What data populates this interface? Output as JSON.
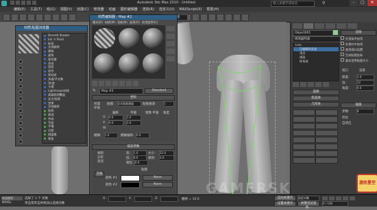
{
  "window": {
    "title": "Autodesk 3ds Max 2010 - Untitled",
    "search_placeholder": "键入关键字或短语"
  },
  "menu": {
    "items": [
      "编辑(E)",
      "工具(T)",
      "组(G)",
      "视图(V)",
      "创建(C)",
      "修改器",
      "动画",
      "图形编辑器",
      "渲染(R)",
      "自定义(U)",
      "MAXScript(X)",
      "帮助(H)"
    ]
  },
  "toolbar": {
    "selection_filter": "全部",
    "view_dropdown": "视图"
  },
  "slate_dialog": {
    "title": "材质/贴图浏览器",
    "list_items": [
      "DirectX Shader",
      "Ink 'n Paint",
      "标准",
      "光线跟踪",
      "建筑",
      "虚拟",
      "变形器",
      "合成",
      "双面",
      "混合",
      "壳材质",
      "多维/子对象",
      "顶/底",
      "卡通",
      "Lightscape材质",
      "高级照明覆盖",
      "无光/投影",
      "虫漆",
      "光线跟踪",
      "贴图",
      "衰减",
      "合成",
      "平面",
      "平铺",
      "位图",
      "棋盘格",
      "渐变"
    ]
  },
  "material_editor": {
    "title": "材质编辑器 - Map #2",
    "menu": [
      "模式(D)",
      "材质(M)",
      "导航(N)",
      "选项(O)",
      "实用程序(U)"
    ],
    "map_name": "Map #2",
    "map_type": "Standard",
    "rollout_coords": "坐标",
    "rollout_noise": "噪波参数",
    "coords": {
      "texture_label": "纹理",
      "env_label": "环境",
      "mapping_label": "贴图:",
      "mapping_value": "显式贴图通道",
      "channel_label": "贴图通道:",
      "channel_value": "1",
      "offset_label": "偏移",
      "tiling_label": "平铺",
      "mirror_tile": "镜像 平铺",
      "angle_label": "角度",
      "u_label": "U:",
      "v_label": "V:",
      "w_label": "W:",
      "u_value": "0.0",
      "v_value": "0.0",
      "tile_u": "1.0",
      "tile_v": "1.0",
      "blur_label": "模糊:",
      "blur_value": "1.0",
      "blur_offset_label": "模糊偏移:",
      "blur_offset_value": "0.0"
    },
    "noise": {
      "type_regular": "规则",
      "type_fractal": "分形",
      "type_turbulence": "湍流",
      "threshold_high_label": "高:",
      "threshold_high": "1.0",
      "threshold_low_label": "低:",
      "threshold_low": "0.0",
      "size_label": "大小:",
      "size_value": "25.0",
      "phase_label": "相位:",
      "phase_value": "0.0",
      "levels_label": "级别:",
      "levels_value": "3.0",
      "color1_label": "颜色 #1",
      "color2_label": "颜色 #2",
      "maps_label": "贴图",
      "none1": "None",
      "none2": "None",
      "swap": "交换"
    }
  },
  "command_panel": {
    "object_name": "Object001",
    "modifier_list": "修改器列表",
    "stack": [
      "Line",
      "可编辑样条线",
      "顶点",
      "线段",
      "样条线"
    ],
    "params_title": "参数",
    "rollout_selection": "选择",
    "rollout_soft": "软选择",
    "rollout_geometry": "几何体",
    "render_group": "渲染",
    "checkboxes": [
      "在渲染中启用",
      "在视口中启用",
      "使用视口设置",
      "生成贴图坐标",
      "真实世界贴图大小"
    ],
    "radios": [
      "视口",
      "渲染"
    ],
    "thickness_label": "厚度:",
    "thickness_value": "1.0",
    "sides_label": "边:",
    "sides_value": "12",
    "angle_label": "角度:",
    "angle_value": "0.0",
    "interp_title": "插值",
    "steps_label": "步数:",
    "steps_value": "6",
    "optimize_label": "优化",
    "adaptive_label": "自适应"
  },
  "status": {
    "selection_text": "选择了 1 个 对象",
    "prompt_text": "单击或单击并拖动以选择对象",
    "welcome": "欢迎使用 MAXSc",
    "x_label": "X:",
    "y_label": "Y:",
    "z_label": "Z:",
    "grid_label": "栅格 = 10.0",
    "autokey": "自动关键点",
    "set_key": "设置关键点",
    "selected": "选定对象",
    "key_filters": "关键点过滤器...",
    "frame_counter": "0 / 100"
  },
  "watermark": "GAMERSKY",
  "logo_text": "游民星空"
}
